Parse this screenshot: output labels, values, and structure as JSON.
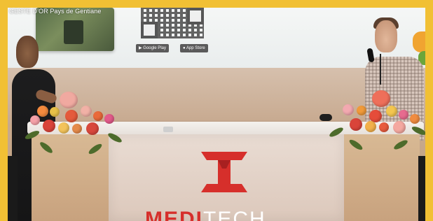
{
  "video": {
    "title": "GESTE D'OR Pays de Gentiane"
  },
  "slide": {
    "store_badges": [
      {
        "label": "Google Play"
      },
      {
        "label": "App Store"
      }
    ]
  },
  "stage": {
    "logo_text_brand": "MEDI",
    "logo_text_rest": "TECH"
  },
  "colors": {
    "frame": "#f1c034",
    "logo_red": "#d62f2b"
  }
}
